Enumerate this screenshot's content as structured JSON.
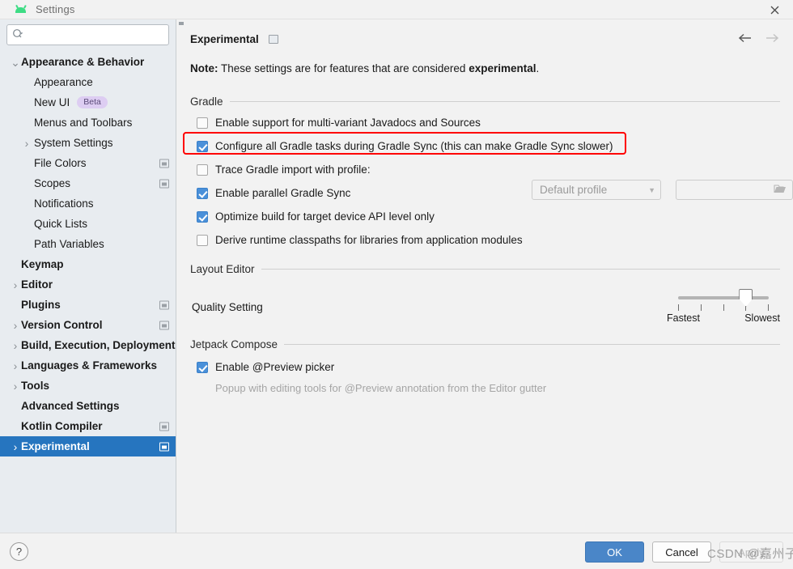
{
  "window": {
    "title": "Settings",
    "app_icon": "android-icon",
    "close_icon": "close-icon"
  },
  "sidebar": {
    "search": {
      "placeholder": "",
      "value": "",
      "icon": "search-icon"
    },
    "items": [
      {
        "label": "Appearance & Behavior",
        "level": 0,
        "twisty": "expanded",
        "bold": true,
        "selected": false,
        "badge": null,
        "project_icon": false
      },
      {
        "label": "Appearance",
        "level": 1,
        "twisty": "none",
        "bold": false,
        "selected": false,
        "badge": null,
        "project_icon": false
      },
      {
        "label": "New UI",
        "level": 1,
        "twisty": "none",
        "bold": false,
        "selected": false,
        "badge": "Beta",
        "project_icon": false
      },
      {
        "label": "Menus and Toolbars",
        "level": 1,
        "twisty": "none",
        "bold": false,
        "selected": false,
        "badge": null,
        "project_icon": false
      },
      {
        "label": "System Settings",
        "level": 1,
        "twisty": "collapsed",
        "bold": false,
        "selected": false,
        "badge": null,
        "project_icon": false
      },
      {
        "label": "File Colors",
        "level": 1,
        "twisty": "none",
        "bold": false,
        "selected": false,
        "badge": null,
        "project_icon": true
      },
      {
        "label": "Scopes",
        "level": 1,
        "twisty": "none",
        "bold": false,
        "selected": false,
        "badge": null,
        "project_icon": true
      },
      {
        "label": "Notifications",
        "level": 1,
        "twisty": "none",
        "bold": false,
        "selected": false,
        "badge": null,
        "project_icon": false
      },
      {
        "label": "Quick Lists",
        "level": 1,
        "twisty": "none",
        "bold": false,
        "selected": false,
        "badge": null,
        "project_icon": false
      },
      {
        "label": "Path Variables",
        "level": 1,
        "twisty": "none",
        "bold": false,
        "selected": false,
        "badge": null,
        "project_icon": false
      },
      {
        "label": "Keymap",
        "level": 0,
        "twisty": "none",
        "bold": true,
        "selected": false,
        "badge": null,
        "project_icon": false
      },
      {
        "label": "Editor",
        "level": 0,
        "twisty": "collapsed",
        "bold": true,
        "selected": false,
        "badge": null,
        "project_icon": false
      },
      {
        "label": "Plugins",
        "level": 0,
        "twisty": "none",
        "bold": true,
        "selected": false,
        "badge": null,
        "project_icon": true
      },
      {
        "label": "Version Control",
        "level": 0,
        "twisty": "collapsed",
        "bold": true,
        "selected": false,
        "badge": null,
        "project_icon": true
      },
      {
        "label": "Build, Execution, Deployment",
        "level": 0,
        "twisty": "collapsed",
        "bold": true,
        "selected": false,
        "badge": null,
        "project_icon": false
      },
      {
        "label": "Languages & Frameworks",
        "level": 0,
        "twisty": "collapsed",
        "bold": true,
        "selected": false,
        "badge": null,
        "project_icon": false
      },
      {
        "label": "Tools",
        "level": 0,
        "twisty": "collapsed",
        "bold": true,
        "selected": false,
        "badge": null,
        "project_icon": false
      },
      {
        "label": "Advanced Settings",
        "level": 0,
        "twisty": "none",
        "bold": true,
        "selected": false,
        "badge": null,
        "project_icon": false
      },
      {
        "label": "Kotlin Compiler",
        "level": 0,
        "twisty": "none",
        "bold": true,
        "selected": false,
        "badge": null,
        "project_icon": true
      },
      {
        "label": "Experimental",
        "level": 0,
        "twisty": "collapsed",
        "bold": true,
        "selected": true,
        "badge": null,
        "project_icon": true
      }
    ]
  },
  "main": {
    "title": "Experimental",
    "nav": {
      "back": "←",
      "forward": "→",
      "back_enabled": true,
      "forward_enabled": false
    },
    "note_prefix": "Note:",
    "note_body": " These settings are for features that are considered ",
    "note_emphasis": "experimental",
    "note_suffix": ".",
    "groups": {
      "gradle": {
        "label": "Gradle",
        "options": [
          {
            "label": "Enable support for multi-variant Javadocs and Sources",
            "checked": false,
            "highlighted": false
          },
          {
            "label": "Configure all Gradle tasks during Gradle Sync (this can make Gradle Sync slower)",
            "checked": true,
            "highlighted": true
          },
          {
            "label": "Trace Gradle import with profile:",
            "checked": false,
            "highlighted": false
          },
          {
            "label": "Enable parallel Gradle Sync",
            "checked": true,
            "highlighted": false
          },
          {
            "label": "Optimize build for target device API level only",
            "checked": true,
            "highlighted": false
          },
          {
            "label": "Derive runtime classpaths for libraries from application modules",
            "checked": false,
            "highlighted": false
          }
        ],
        "profile_combo": {
          "value": "Default profile",
          "icon": "chevron-down-icon"
        },
        "profile_path": {
          "value": "",
          "icon": "folder-icon"
        }
      },
      "layout_editor": {
        "label": "Layout Editor",
        "quality_label": "Quality Setting",
        "slider": {
          "min_label": "Fastest",
          "max_label": "Slowest",
          "ticks": 5,
          "value": 4
        }
      },
      "jetpack_compose": {
        "label": "Jetpack Compose",
        "options": [
          {
            "label": "Enable @Preview picker",
            "checked": true,
            "highlighted": false
          }
        ],
        "sub_note": "Popup with editing tools for @Preview annotation from the Editor gutter"
      }
    }
  },
  "footer": {
    "help_label": "?",
    "ok_label": "OK",
    "cancel_label": "Cancel",
    "apply_label": "Apply",
    "watermark": "CSDN @嘉州子"
  },
  "colors": {
    "accent_blue": "#2675bf",
    "checkbox_blue": "#4a90d9",
    "ok_button": "#4a86c8",
    "highlight_red": "#ff0000",
    "badge_bg": "#ddcdf2",
    "sidebar_bg": "#e8ecf0",
    "panel_bg": "#f2f2f2"
  }
}
